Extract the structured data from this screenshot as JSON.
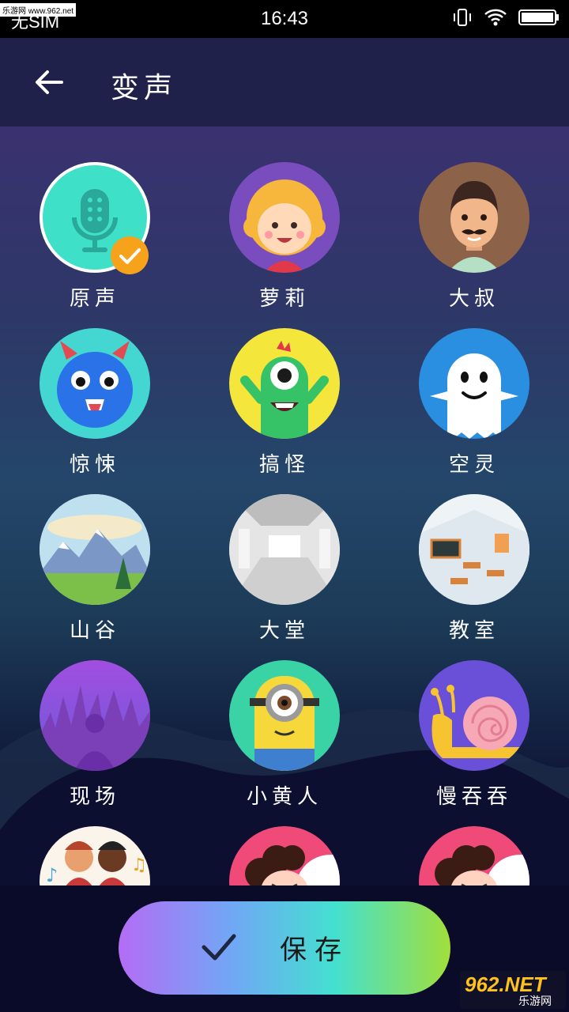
{
  "status": {
    "carrier": "无SIM",
    "time": "16:43",
    "watermark_top": "乐游网 www.962.net"
  },
  "appbar": {
    "title": "变声"
  },
  "voices": [
    {
      "label": "原声",
      "selected": true
    },
    {
      "label": "萝莉"
    },
    {
      "label": "大叔"
    },
    {
      "label": "惊悚"
    },
    {
      "label": "搞怪"
    },
    {
      "label": "空灵"
    },
    {
      "label": "山谷"
    },
    {
      "label": "大堂"
    },
    {
      "label": "教室"
    },
    {
      "label": "现场"
    },
    {
      "label": "小黄人"
    },
    {
      "label": "慢吞吞"
    }
  ],
  "save": {
    "label": "保存"
  },
  "watermark_bottom": {
    "brand": "962.NET",
    "sub": "乐游网"
  }
}
